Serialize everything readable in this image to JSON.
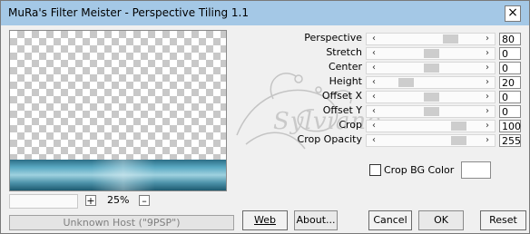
{
  "window": {
    "title": "MuRa's Filter Meister - Perspective Tiling 1.1",
    "close_glyph": "×"
  },
  "preview": {
    "zoom": "25%",
    "zoom_minus": "–",
    "zoom_plus": "+",
    "status": "Unknown Host (\"9PSP\")"
  },
  "watermark": {
    "text": "Sylviane"
  },
  "params": [
    {
      "label": "Perspective",
      "value": "80",
      "level": 0.72
    },
    {
      "label": "Stretch",
      "value": "0",
      "level": 0.5
    },
    {
      "label": "Center",
      "value": "0",
      "level": 0.5
    },
    {
      "label": "Height",
      "value": "20",
      "level": 0.2
    },
    {
      "label": "Offset X",
      "value": "0",
      "level": 0.5
    },
    {
      "label": "Offset Y",
      "value": "0",
      "level": 0.5
    },
    {
      "label": "Crop",
      "value": "100",
      "level": 0.82
    },
    {
      "label": "Crop Opacity",
      "value": "255",
      "level": 0.82
    }
  ],
  "slider_arrows": {
    "left": "‹",
    "right": "›"
  },
  "crop_bg": {
    "label": "Crop BG Color",
    "checked": false,
    "color": "#ffffff"
  },
  "buttons": {
    "web": "Web",
    "about": "About...",
    "cancel": "Cancel",
    "ok": "OK",
    "reset": "Reset"
  }
}
